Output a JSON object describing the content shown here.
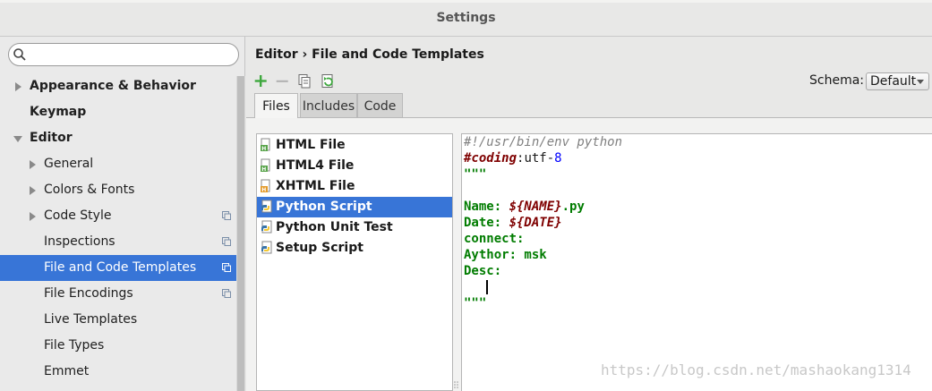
{
  "window": {
    "title": "Settings"
  },
  "search": {
    "placeholder": "",
    "value": ""
  },
  "sidebar": {
    "items": [
      {
        "label": "Appearance & Behavior",
        "bold": true,
        "arrow": "right",
        "indent": 0
      },
      {
        "label": "Keymap",
        "bold": true,
        "arrow": "none",
        "indent": 0
      },
      {
        "label": "Editor",
        "bold": true,
        "arrow": "down",
        "indent": 0
      },
      {
        "label": "General",
        "bold": false,
        "arrow": "right",
        "indent": 1
      },
      {
        "label": "Colors & Fonts",
        "bold": false,
        "arrow": "right",
        "indent": 1
      },
      {
        "label": "Code Style",
        "bold": false,
        "arrow": "right",
        "indent": 1,
        "project_icon": true
      },
      {
        "label": "Inspections",
        "bold": false,
        "arrow": "none",
        "indent": 1,
        "project_icon": true
      },
      {
        "label": "File and Code Templates",
        "bold": false,
        "arrow": "none",
        "indent": 1,
        "project_icon": true,
        "selected": true
      },
      {
        "label": "File Encodings",
        "bold": false,
        "arrow": "none",
        "indent": 1,
        "project_icon": true
      },
      {
        "label": "Live Templates",
        "bold": false,
        "arrow": "none",
        "indent": 1
      },
      {
        "label": "File Types",
        "bold": false,
        "arrow": "none",
        "indent": 1
      },
      {
        "label": "Emmet",
        "bold": false,
        "arrow": "none",
        "indent": 1
      }
    ]
  },
  "main": {
    "breadcrumb": "Editor › File and Code Templates",
    "toolbar": [
      "add-icon",
      "remove-icon",
      "copy-icon",
      "reset-icon"
    ],
    "schema_label": "Schema:",
    "schema_value": "Default",
    "tabs": [
      {
        "label": "Files",
        "active": true
      },
      {
        "label": "Includes",
        "active": false
      },
      {
        "label": "Code",
        "active": false
      }
    ],
    "files": [
      {
        "label": "HTML File",
        "icon": "html-file-icon"
      },
      {
        "label": "HTML4 File",
        "icon": "html-file-icon"
      },
      {
        "label": "XHTML File",
        "icon": "xhtml-file-icon"
      },
      {
        "label": "Python Script",
        "icon": "python-file-icon",
        "selected": true
      },
      {
        "label": "Python Unit Test",
        "icon": "python-file-icon"
      },
      {
        "label": "Setup Script",
        "icon": "python-file-icon"
      }
    ],
    "code_lines": [
      [
        {
          "t": "#!/usr/bin/env python",
          "c": "c-comment"
        }
      ],
      [
        {
          "t": "#coding",
          "c": "c-kw"
        },
        {
          "t": ":utf-",
          "c": "c-plain"
        },
        {
          "t": "8",
          "c": "c-num"
        }
      ],
      [
        {
          "t": "\"\"\"",
          "c": "c-str"
        }
      ],
      [
        {
          "t": "",
          "c": "c-plain"
        }
      ],
      [
        {
          "t": "Name: ",
          "c": "c-str"
        },
        {
          "t": "${NAME}",
          "c": "c-var"
        },
        {
          "t": ".py",
          "c": "c-str"
        }
      ],
      [
        {
          "t": "Date: ",
          "c": "c-str"
        },
        {
          "t": "${DATE}",
          "c": "c-var"
        }
      ],
      [
        {
          "t": "connect:",
          "c": "c-str"
        }
      ],
      [
        {
          "t": "Aythor: msk",
          "c": "c-str"
        }
      ],
      [
        {
          "t": "Desc:",
          "c": "c-str"
        }
      ],
      [
        {
          "t": "",
          "c": "c-plain"
        }
      ],
      [
        {
          "t": "\"\"\"",
          "c": "c-str"
        }
      ]
    ]
  },
  "watermark": "https://blog.csdn.net/mashaokang1314",
  "colors": {
    "selection": "#3875d7",
    "add": "#3ea83e"
  }
}
